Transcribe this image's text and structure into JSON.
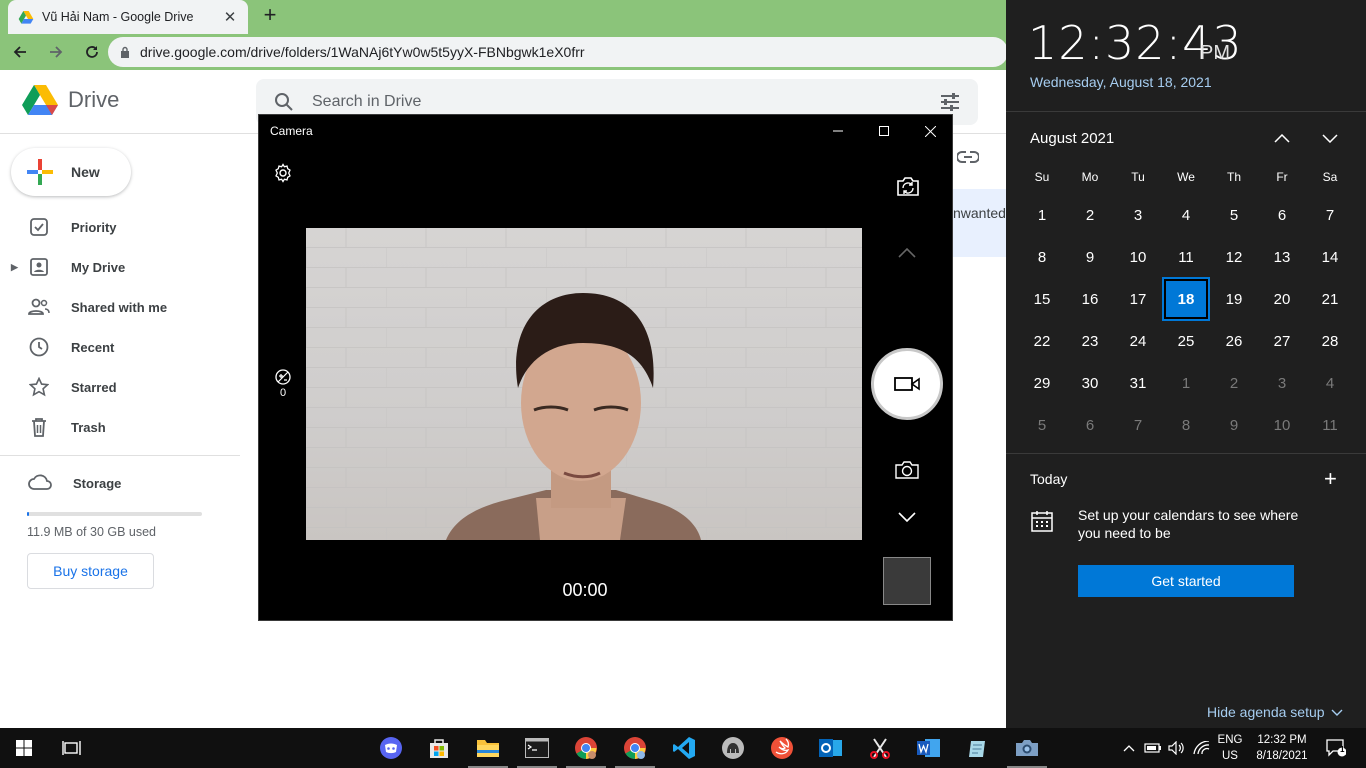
{
  "browser": {
    "tab_title": "Vũ Hải Nam - Google Drive",
    "url": "drive.google.com/drive/folders/1WaNAj6tYw0w5t5yyX-FBNbgwk1eX0frr"
  },
  "drive": {
    "logo_text": "Drive",
    "search_placeholder": "Search in Drive",
    "new_label": "New",
    "nav": [
      {
        "label": "Priority"
      },
      {
        "label": "My Drive"
      },
      {
        "label": "Shared with me"
      },
      {
        "label": "Recent"
      },
      {
        "label": "Starred"
      },
      {
        "label": "Trash"
      }
    ],
    "storage_label": "Storage",
    "storage_used_text": "11.9 MB of 30 GB used",
    "storage_fraction": 0.0004,
    "buy_storage": "Buy storage",
    "file_partial": "nwanted"
  },
  "camera": {
    "title": "Camera",
    "exposure_value": "0",
    "timer": "00:00"
  },
  "calendar": {
    "time": "12:32:43",
    "ampm": "PM",
    "date": "Wednesday, August 18, 2021",
    "month": "August 2021",
    "weekdays": [
      "Su",
      "Mo",
      "Tu",
      "We",
      "Th",
      "Fr",
      "Sa"
    ],
    "days": [
      [
        "1",
        "2",
        "3",
        "4",
        "5",
        "6",
        "7"
      ],
      [
        "8",
        "9",
        "10",
        "11",
        "12",
        "13",
        "14"
      ],
      [
        "15",
        "16",
        "17",
        "18",
        "19",
        "20",
        "21"
      ],
      [
        "22",
        "23",
        "24",
        "25",
        "26",
        "27",
        "28"
      ],
      [
        "29",
        "30",
        "31",
        "1",
        "2",
        "3",
        "4"
      ],
      [
        "5",
        "6",
        "7",
        "8",
        "9",
        "10",
        "11"
      ]
    ],
    "selected_day": "18",
    "today_label": "Today",
    "agenda_text": "Set up your calendars to see where you need to be",
    "get_started": "Get started",
    "hide_agenda": "Hide agenda setup"
  },
  "taskbar": {
    "lang_top": "ENG",
    "lang_bottom": "US",
    "clock_time": "12:32 PM",
    "clock_date": "8/18/2021",
    "notification_count": "1"
  },
  "colors": {
    "chrome_frame": "#8bc47a",
    "drive_blue": "#1a73e8",
    "windows_accent": "#0078d7",
    "flyout_bg": "#1f1f1f"
  }
}
